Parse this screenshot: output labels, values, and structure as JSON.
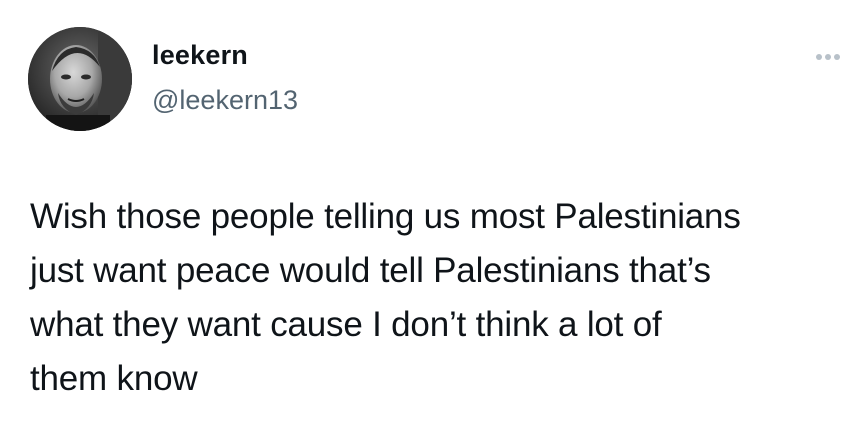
{
  "tweet": {
    "author": {
      "display_name": "leekern",
      "handle": "@leekern13"
    },
    "text": "Wish those people telling us most Palestinians\njust want peace would tell Palestinians that’s\nwhat they want cause I don’t think a lot of\nthem know"
  },
  "icons": {
    "more": "more-horizontal-icon"
  },
  "colors": {
    "text_primary": "#0f1419",
    "text_secondary": "#536471",
    "icon_muted": "#b8c1c9",
    "background": "#ffffff"
  }
}
